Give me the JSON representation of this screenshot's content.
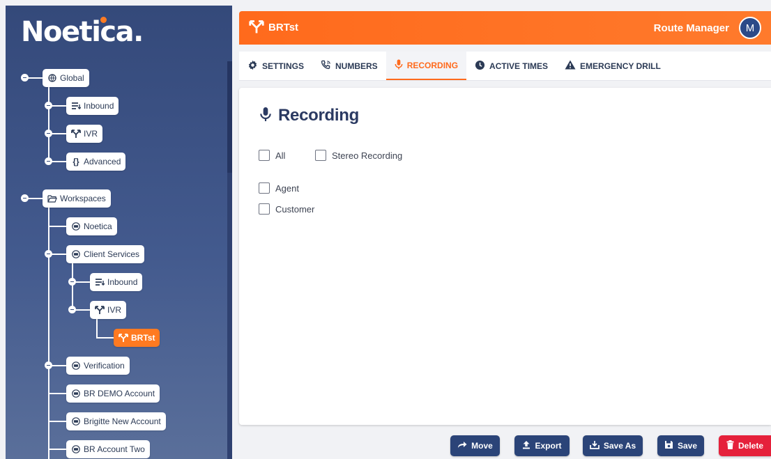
{
  "brand": {
    "logo_text": "Noetica",
    "logo_dot": "."
  },
  "tree": {
    "global": "Global",
    "global_children": [
      "Inbound",
      "IVR",
      "Advanced"
    ],
    "workspaces": "Workspaces",
    "noetica": "Noetica",
    "client_services": "Client Services",
    "client_services_children": [
      "Inbound",
      "IVR"
    ],
    "active_route": "BRTst",
    "other_workspaces": [
      "Verification",
      "BR DEMO Account",
      "Brigitte New Account",
      "BR Account Two"
    ]
  },
  "header": {
    "title": "BRTst",
    "app_name": "Route Manager",
    "avatar_initial": "M"
  },
  "tabs": [
    {
      "label": "SETTINGS",
      "icon": "gear-icon"
    },
    {
      "label": "NUMBERS",
      "icon": "phone-icon"
    },
    {
      "label": "RECORDING",
      "icon": "microphone-icon",
      "active": true
    },
    {
      "label": "ACTIVE TIMES",
      "icon": "clock-icon"
    },
    {
      "label": "EMERGENCY DRILL",
      "icon": "warning-icon"
    }
  ],
  "recording": {
    "title": "Recording",
    "options": [
      {
        "label": "All",
        "checked": false
      },
      {
        "label": "Stereo Recording",
        "checked": false
      },
      {
        "label": "Agent",
        "checked": false
      },
      {
        "label": "Customer",
        "checked": false
      }
    ]
  },
  "actions": {
    "move": "Move",
    "export": "Export",
    "save_as": "Save As",
    "save": "Save",
    "delete": "Delete"
  },
  "colors": {
    "accent": "#ff6a1c",
    "navy": "#2b4478",
    "danger": "#e5213b",
    "sidebar": "#34497a"
  }
}
